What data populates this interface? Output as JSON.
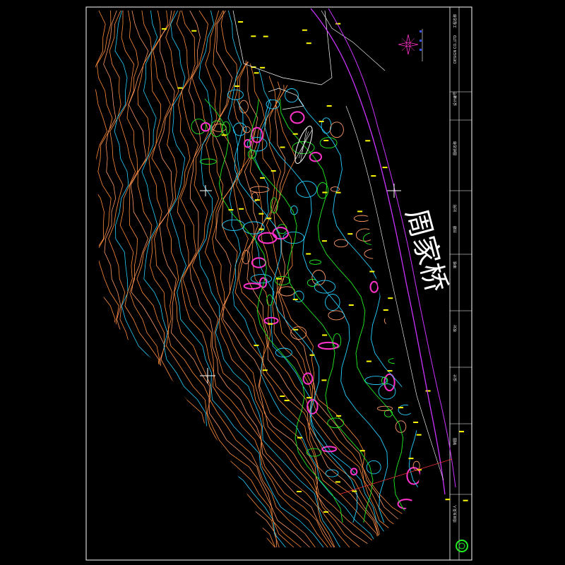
{
  "drawing": {
    "street_name": "周家桥",
    "colors": {
      "frame": "#ffffff",
      "contour_orange": "#ff8c3a",
      "contour_salmon": "#ff9966",
      "contour_cyan": "#25d0ff",
      "contour_green": "#22ee22",
      "contour_magenta": "#ff33cc",
      "road_magenta": "#cc33ff",
      "elevation_label": "#ffff00"
    }
  },
  "north_arrow": {
    "icon": "north-arrow-icon"
  },
  "title_block": {
    "rows": [
      "工程名称",
      "DESIGN CO.,LTD",
      "设计编号",
      "图纸名称",
      "比例",
      "日期",
      "审核",
      "校对",
      "设计",
      "制图",
      "项目负责人"
    ],
    "logo_icon": "company-logo-icon"
  }
}
